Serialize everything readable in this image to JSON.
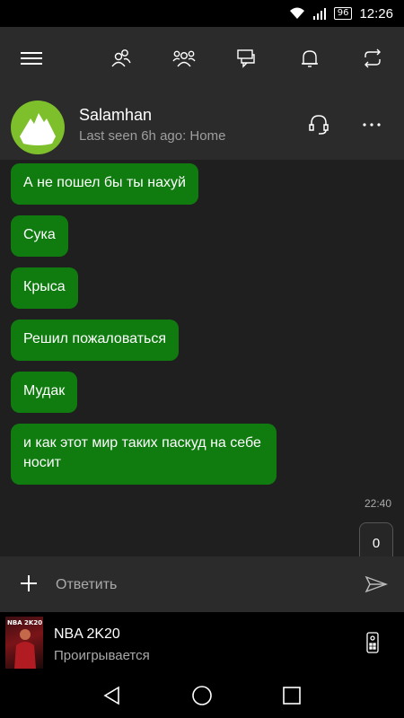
{
  "status_bar": {
    "battery": "96",
    "time": "12:26"
  },
  "contact": {
    "name": "Salamhan",
    "status": "Last seen 6h ago: Home"
  },
  "messages": [
    {
      "text": "А не пошел бы ты нахуй"
    },
    {
      "text": "Сука"
    },
    {
      "text": "Крыса"
    },
    {
      "text": "Решил пожаловаться"
    },
    {
      "text": "Мудак"
    },
    {
      "text": "и как этот мир таких паскуд на себе носит"
    }
  ],
  "timestamp": "22:40",
  "counter": "0",
  "reply": {
    "placeholder": "Ответить"
  },
  "now_playing": {
    "art_label": "NBA 2K20",
    "title": "NBA 2K20",
    "status": "Проигрывается"
  },
  "icons": [
    "wifi-icon",
    "signal-icon",
    "menu-icon",
    "friends-icon",
    "party-icon",
    "messages-icon",
    "notifications-icon",
    "switch-icon",
    "headset-icon",
    "more-icon",
    "plus-icon",
    "send-icon",
    "remote-icon",
    "back-icon",
    "home-icon",
    "recents-icon"
  ]
}
